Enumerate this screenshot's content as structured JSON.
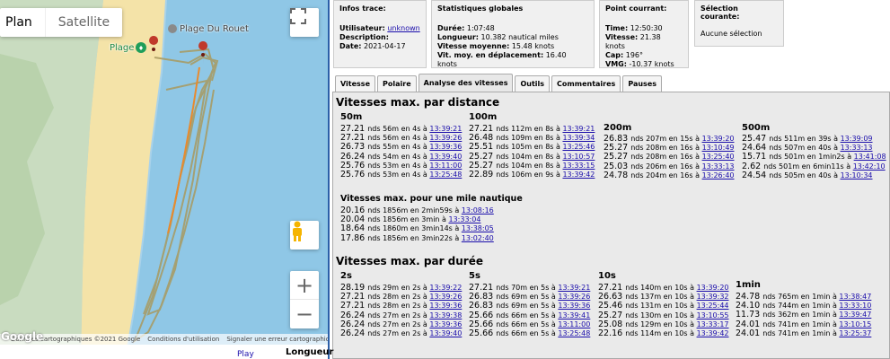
{
  "map": {
    "type_plan": "Plan",
    "type_satellite": "Satellite",
    "poi_plage": "Plage",
    "poi_rouet": "Plage Du Rouet",
    "google": "Google",
    "attrib_data": "Données cartographiques ©2021 Google",
    "attrib_terms": "Conditions d'utilisation",
    "attrib_report": "Signaler une erreur cartographique",
    "play": "Play",
    "longueur": "Longueur",
    "zoom_in": "+",
    "zoom_out": "−",
    "colors": {
      "sea": "#8fc7e6",
      "sand": "#f4e3a8",
      "land": "#c9dcc0",
      "track": "#c98b3c"
    }
  },
  "infos_trace": {
    "title": "Infos trace:",
    "user_label": "Utilisateur:",
    "user_value": "unknown",
    "desc_label": "Description:",
    "desc_value": "",
    "date_label": "Date:",
    "date_value": "2021-04-17"
  },
  "stats": {
    "title": "Statistiques globales",
    "duree_label": "Durée:",
    "duree_value": "1:07:48",
    "longueur_label": "Longueur:",
    "longueur_value": "10.382 nautical miles",
    "vmoy_label": "Vitesse moyenne:",
    "vmoy_value": "15.48 knots",
    "vmoyd_label": "Vit. moy. en déplacement:",
    "vmoyd_value": "16.40 knots"
  },
  "point": {
    "title": "Point courrant:",
    "time_label": "Time:",
    "time_value": "12:50:30",
    "vitesse_label": "Vitesse:",
    "vitesse_value": "21.38 knots",
    "cap_label": "Cap:",
    "cap_value": "196°",
    "vmg_label": "VMG:",
    "vmg_value": "-10.37 knots"
  },
  "selection": {
    "title": "Sélection courante:",
    "value": "Aucune sélection"
  },
  "tabs": [
    "Vitesse",
    "Polaire",
    "Analyse des vitesses",
    "Outils",
    "Commentaires",
    "Pauses"
  ],
  "distance": {
    "title": "Vitesses max. par distance",
    "cols": [
      {
        "header": "50m",
        "rows": [
          {
            "t": "27.21 ",
            "d": "nds 56m en 4s à ",
            "l": "13:39:21"
          },
          {
            "t": "27.21 ",
            "d": "nds 56m en 4s à ",
            "l": "13:39:26"
          },
          {
            "t": "26.73 ",
            "d": "nds 55m en 4s à ",
            "l": "13:39:36"
          },
          {
            "t": "26.24 ",
            "d": "nds 54m en 4s à ",
            "l": "13:39:40"
          },
          {
            "t": "25.76 ",
            "d": "nds 53m en 4s à ",
            "l": "13:11:00"
          },
          {
            "t": "25.76 ",
            "d": "nds 53m en 4s à ",
            "l": "13:25:48"
          }
        ]
      },
      {
        "header": "100m",
        "rows": [
          {
            "t": "27.21 ",
            "d": "nds 112m en 8s à ",
            "l": "13:39:21"
          },
          {
            "t": "26.48 ",
            "d": "nds 109m en 8s à ",
            "l": "13:39:34"
          },
          {
            "t": "25.51 ",
            "d": "nds 105m en 8s à ",
            "l": "13:25:46"
          },
          {
            "t": "25.27 ",
            "d": "nds 104m en 8s à ",
            "l": "13:10:57"
          },
          {
            "t": "25.27 ",
            "d": "nds 104m en 8s à ",
            "l": "13:33:15"
          },
          {
            "t": "22.89 ",
            "d": "nds 106m en 9s à ",
            "l": "13:39:42"
          }
        ]
      },
      {
        "header": "200m",
        "rows": [
          {
            "t": "26.83 ",
            "d": "nds 207m en 15s à ",
            "l": "13:39:20"
          },
          {
            "t": "25.27 ",
            "d": "nds 208m en 16s à ",
            "l": "13:10:49"
          },
          {
            "t": "25.27 ",
            "d": "nds 208m en 16s à ",
            "l": "13:25:40"
          },
          {
            "t": "25.03 ",
            "d": "nds 206m en 16s à ",
            "l": "13:33:13"
          },
          {
            "t": "24.78 ",
            "d": "nds 204m en 16s à ",
            "l": "13:26:40"
          }
        ]
      },
      {
        "header": "500m",
        "rows": [
          {
            "t": "25.47 ",
            "d": "nds 511m en 39s à ",
            "l": "13:39:09"
          },
          {
            "t": "24.64 ",
            "d": "nds 507m en 40s à ",
            "l": "13:33:13"
          },
          {
            "t": "15.71 ",
            "d": "nds 501m en 1min2s à ",
            "l": "13:41:08"
          },
          {
            "t": "2.62 ",
            "d": "nds 501m en 6min11s à ",
            "l": "13:42:10"
          },
          {
            "t": "24.54 ",
            "d": "nds 505m en 40s à ",
            "l": "13:10:34"
          }
        ]
      }
    ],
    "mile_title": "Vitesses max. pour une mile nautique",
    "mile_rows": [
      {
        "t": "20.16 ",
        "d": "nds 1856m en 2min59s à ",
        "l": "13:08:16"
      },
      {
        "t": "20.04 ",
        "d": "nds 1856m en 3min à ",
        "l": "13:33:04"
      },
      {
        "t": "18.64 ",
        "d": "nds 1860m en 3min14s à ",
        "l": "13:38:05"
      },
      {
        "t": "17.86 ",
        "d": "nds 1856m en 3min22s à ",
        "l": "13:02:40"
      }
    ]
  },
  "duree": {
    "title": "Vitesses max. par durée",
    "cols": [
      {
        "header": "2s",
        "rows": [
          {
            "t": "28.19 ",
            "d": "nds 29m en 2s à ",
            "l": "13:39:22"
          },
          {
            "t": "27.21 ",
            "d": "nds 28m en 2s à ",
            "l": "13:39:26"
          },
          {
            "t": "27.21 ",
            "d": "nds 28m en 2s à ",
            "l": "13:39:36"
          },
          {
            "t": "26.24 ",
            "d": "nds 27m en 2s à ",
            "l": "13:39:38"
          },
          {
            "t": "26.24 ",
            "d": "nds 27m en 2s à ",
            "l": "13:39:36"
          },
          {
            "t": "26.24 ",
            "d": "nds 27m en 2s à ",
            "l": "13:39:40"
          }
        ]
      },
      {
        "header": "5s",
        "rows": [
          {
            "t": "27.21 ",
            "d": "nds 70m en 5s à ",
            "l": "13:39:21"
          },
          {
            "t": "26.83 ",
            "d": "nds 69m en 5s à ",
            "l": "13:39:26"
          },
          {
            "t": "26.83 ",
            "d": "nds 69m en 5s à ",
            "l": "13:39:36"
          },
          {
            "t": "25.66 ",
            "d": "nds 66m en 5s à ",
            "l": "13:39:41"
          },
          {
            "t": "25.66 ",
            "d": "nds 66m en 5s à ",
            "l": "13:11:00"
          },
          {
            "t": "25.66 ",
            "d": "nds 66m en 5s à ",
            "l": "13:25:48"
          }
        ]
      },
      {
        "header": "10s",
        "rows": [
          {
            "t": "27.21 ",
            "d": "nds 140m en 10s à ",
            "l": "13:39:20"
          },
          {
            "t": "26.63 ",
            "d": "nds 137m en 10s à ",
            "l": "13:39:32"
          },
          {
            "t": "25.46 ",
            "d": "nds 131m en 10s à ",
            "l": "13:25:44"
          },
          {
            "t": "25.27 ",
            "d": "nds 130m en 10s à ",
            "l": "13:10:55"
          },
          {
            "t": "25.08 ",
            "d": "nds 129m en 10s à ",
            "l": "13:33:17"
          },
          {
            "t": "22.16 ",
            "d": "nds 114m en 10s à ",
            "l": "13:39:42"
          }
        ]
      },
      {
        "header": "1min",
        "rows": [
          {
            "t": "24.78 ",
            "d": "nds 765m en 1min à ",
            "l": "13:38:47"
          },
          {
            "t": "24.10 ",
            "d": "nds 744m en 1min à ",
            "l": "13:33:10"
          },
          {
            "t": "11.73 ",
            "d": "nds 362m en 1min à ",
            "l": "13:39:47"
          },
          {
            "t": "24.01 ",
            "d": "nds 741m en 1min à ",
            "l": "13:10:15"
          },
          {
            "t": "24.01 ",
            "d": "nds 741m en 1min à ",
            "l": "13:25:37"
          }
        ]
      }
    ]
  }
}
